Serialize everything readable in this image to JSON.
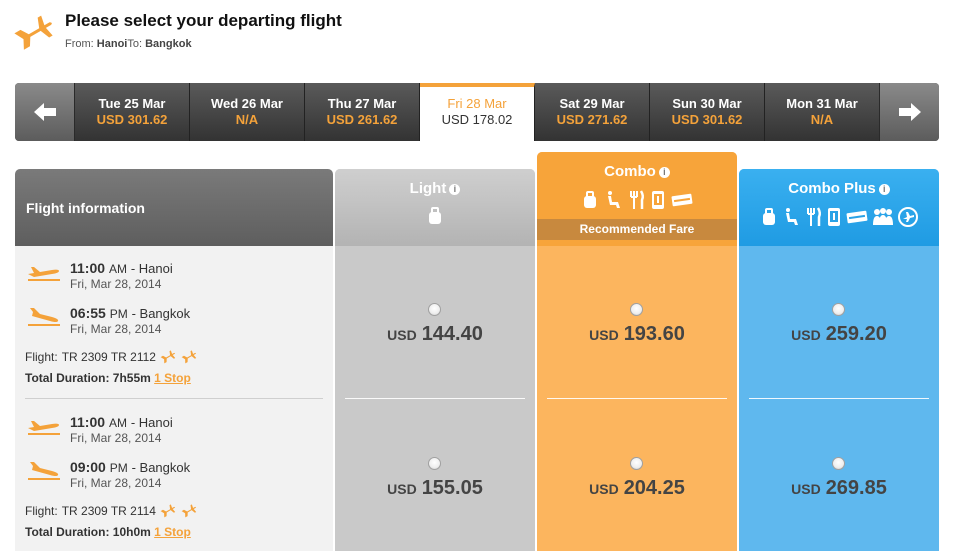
{
  "header": {
    "title": "Please select your departing flight",
    "from_label": "From:",
    "from_city": "Hanoi",
    "to_label": "To:",
    "to_city": "Bangkok"
  },
  "date_bar": {
    "dates": [
      {
        "day": "Tue 25 Mar",
        "price": "USD 301.62",
        "active": false
      },
      {
        "day": "Wed 26 Mar",
        "price": "N/A",
        "active": false
      },
      {
        "day": "Thu 27 Mar",
        "price": "USD 261.62",
        "active": false
      },
      {
        "day": "Fri 28 Mar",
        "price": "USD 178.02",
        "active": true
      },
      {
        "day": "Sat 29 Mar",
        "price": "USD 271.62",
        "active": false
      },
      {
        "day": "Sun 30 Mar",
        "price": "USD 301.62",
        "active": false
      },
      {
        "day": "Mon 31 Mar",
        "price": "N/A",
        "active": false
      }
    ]
  },
  "columns": {
    "info_header": "Flight information",
    "light": {
      "name": "Light",
      "icons": [
        "baggage-icon"
      ]
    },
    "combo": {
      "name": "Combo",
      "recommended": "Recommended Fare",
      "icons": [
        "baggage-icon",
        "seat-icon",
        "meal-icon",
        "device-icon",
        "ticket-icon"
      ]
    },
    "combo_plus": {
      "name": "Combo Plus",
      "icons": [
        "baggage-icon",
        "seat-icon",
        "meal-icon",
        "device-icon",
        "ticket-icon",
        "group-icon",
        "flight-change-icon"
      ]
    }
  },
  "flights": [
    {
      "depart_time": "11:00",
      "depart_ampm": "AM",
      "depart_city": "- Hanoi",
      "depart_date": "Fri, Mar 28, 2014",
      "arrive_time": "06:55",
      "arrive_ampm": "PM",
      "arrive_city": "- Bangkok",
      "arrive_date": "Fri, Mar 28, 2014",
      "flight_label": "Flight:",
      "flight_no": "TR 2309 TR 2112",
      "duration_label": "Total Duration: 7h55m",
      "stops": "1 Stop",
      "fares": {
        "currency": "USD",
        "light": "144.40",
        "combo": "193.60",
        "combo_plus": "259.20"
      }
    },
    {
      "depart_time": "11:00",
      "depart_ampm": "AM",
      "depart_city": "- Hanoi",
      "depart_date": "Fri, Mar 28, 2014",
      "arrive_time": "09:00",
      "arrive_ampm": "PM",
      "arrive_city": "- Bangkok",
      "arrive_date": "Fri, Mar 28, 2014",
      "flight_label": "Flight:",
      "flight_no": "TR 2309 TR 2114",
      "duration_label": "Total Duration: 10h0m",
      "stops": "1 Stop",
      "fares": {
        "currency": "USD",
        "light": "155.05",
        "combo": "204.25",
        "combo_plus": "269.85"
      }
    }
  ],
  "colors": {
    "accent": "#f4a23a",
    "light": "#c9c9c9",
    "combo": "#fcb55e",
    "combo_plus": "#5fb8ee"
  }
}
